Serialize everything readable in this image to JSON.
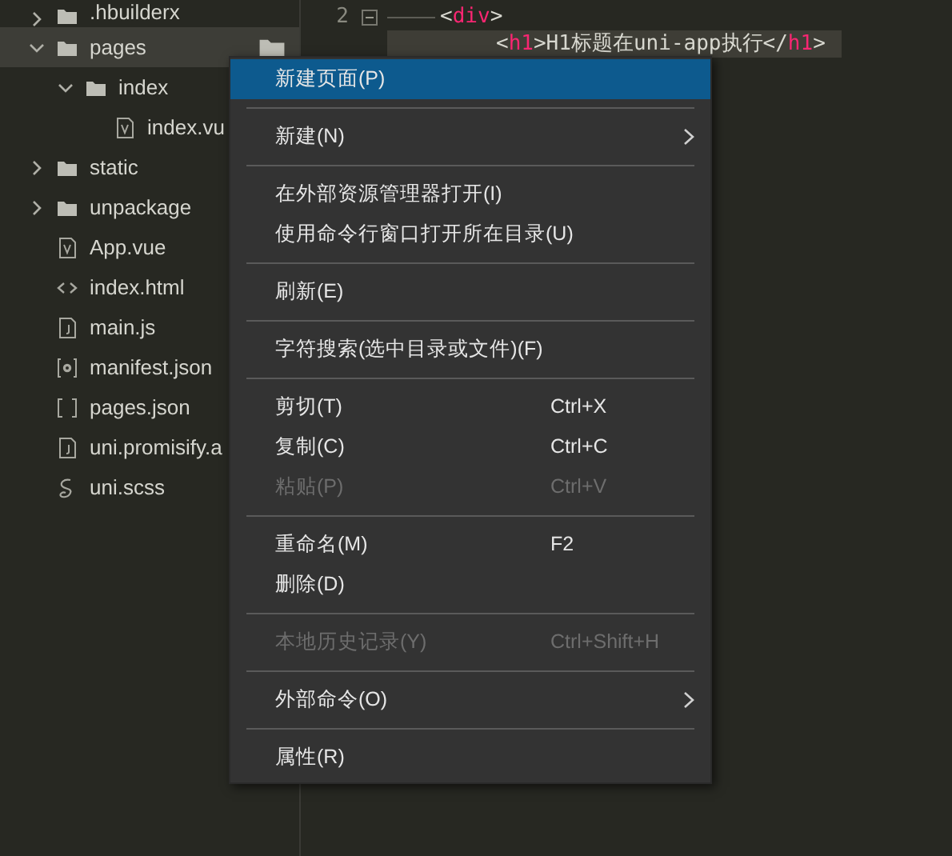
{
  "tree": [
    {
      "label": ".hbuilderx",
      "kind": "folder",
      "expanded": false,
      "selected": false
    },
    {
      "label": "pages",
      "kind": "folder",
      "expanded": true,
      "selected": true,
      "children": [
        {
          "label": "index",
          "kind": "folder",
          "expanded": true,
          "selected": false,
          "children": [
            {
              "label": "index.vu",
              "kind": "vue",
              "selected": false
            }
          ]
        }
      ]
    },
    {
      "label": "static",
      "kind": "folder",
      "expanded": false,
      "selected": false
    },
    {
      "label": "unpackage",
      "kind": "folder",
      "expanded": false,
      "selected": false
    },
    {
      "label": "App.vue",
      "kind": "vue",
      "selected": false
    },
    {
      "label": "index.html",
      "kind": "html",
      "selected": false
    },
    {
      "label": "main.js",
      "kind": "js",
      "selected": false
    },
    {
      "label": "manifest.json",
      "kind": "manifest",
      "selected": false
    },
    {
      "label": "pages.json",
      "kind": "brackets",
      "selected": false
    },
    {
      "label": "uni.promisify.a",
      "kind": "js",
      "selected": false
    },
    {
      "label": "uni.scss",
      "kind": "sass",
      "selected": false
    }
  ],
  "editor": {
    "lines": [
      {
        "number": "2",
        "foldable": true,
        "highlighted": false,
        "tokens": [
          {
            "text": "<",
            "kind": "punct"
          },
          {
            "text": "div",
            "kind": "tag"
          },
          {
            "text": ">",
            "kind": "punct"
          }
        ]
      },
      {
        "highlighted": true,
        "tokens": [
          {
            "text": "<",
            "kind": "punct"
          },
          {
            "text": "h1",
            "kind": "tag"
          },
          {
            "text": ">H1标题在uni-app执行</",
            "kind": "punct"
          },
          {
            "text": "h1",
            "kind": "tag"
          },
          {
            "text": ">",
            "kind": "punct"
          }
        ]
      }
    ]
  },
  "context_menu": [
    {
      "kind": "item",
      "label": "新建页面(P)",
      "selected": true,
      "disabled": false
    },
    {
      "kind": "separator"
    },
    {
      "kind": "item",
      "label": "新建(N)",
      "selected": false,
      "disabled": false,
      "submenu": true
    },
    {
      "kind": "separator"
    },
    {
      "kind": "item",
      "label": "在外部资源管理器打开(I)",
      "selected": false,
      "disabled": false
    },
    {
      "kind": "item",
      "label": "使用命令行窗口打开所在目录(U)",
      "selected": false,
      "disabled": false
    },
    {
      "kind": "separator"
    },
    {
      "kind": "item",
      "label": "刷新(E)",
      "selected": false,
      "disabled": false
    },
    {
      "kind": "separator"
    },
    {
      "kind": "item",
      "label": "字符搜索(选中目录或文件)(F)",
      "selected": false,
      "disabled": false
    },
    {
      "kind": "separator"
    },
    {
      "kind": "item",
      "label": "剪切(T)",
      "shortcut": "Ctrl+X",
      "selected": false,
      "disabled": false
    },
    {
      "kind": "item",
      "label": "复制(C)",
      "shortcut": "Ctrl+C",
      "selected": false,
      "disabled": false
    },
    {
      "kind": "item",
      "label": "粘贴(P)",
      "shortcut": "Ctrl+V",
      "selected": false,
      "disabled": true
    },
    {
      "kind": "separator"
    },
    {
      "kind": "item",
      "label": "重命名(M)",
      "shortcut": "F2",
      "selected": false,
      "disabled": false
    },
    {
      "kind": "item",
      "label": "删除(D)",
      "selected": false,
      "disabled": false
    },
    {
      "kind": "separator"
    },
    {
      "kind": "item",
      "label": "本地历史记录(Y)",
      "shortcut": "Ctrl+Shift+H",
      "selected": false,
      "disabled": true
    },
    {
      "kind": "separator"
    },
    {
      "kind": "item",
      "label": "外部命令(O)",
      "selected": false,
      "disabled": false,
      "submenu": true
    },
    {
      "kind": "separator"
    },
    {
      "kind": "item",
      "label": "属性(R)",
      "selected": false,
      "disabled": false
    }
  ]
}
